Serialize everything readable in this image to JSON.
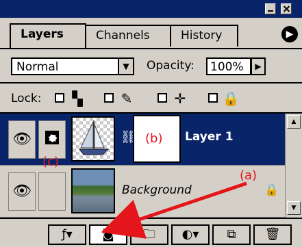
{
  "tabs": [
    {
      "label": "Layers",
      "active": true
    },
    {
      "label": "Channels",
      "active": false
    },
    {
      "label": "History",
      "active": false
    }
  ],
  "blend_mode": "Normal",
  "opacity_label": "Opacity:",
  "opacity_value": "100%",
  "lock_label": "Lock:",
  "layers": [
    {
      "name": "Layer 1",
      "selected": true
    },
    {
      "name": "Background",
      "selected": false
    }
  ],
  "annotations": {
    "a": "(a)",
    "b": "(b)",
    "c": "(c)"
  },
  "colors": {
    "selection": "#0a246a",
    "panel": "#d4d0c8",
    "annotation": "#e4161b"
  }
}
